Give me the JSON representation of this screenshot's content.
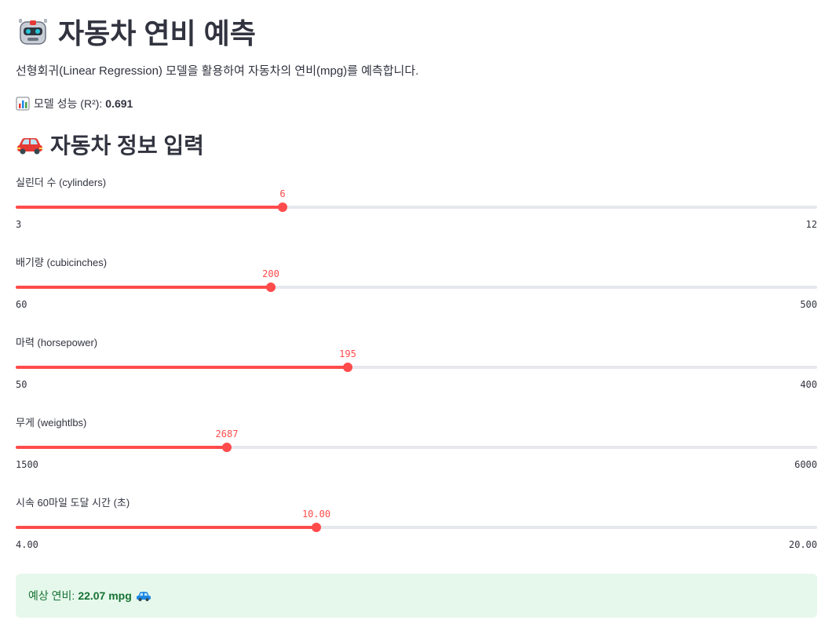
{
  "header": {
    "title": "자동차 연비 예측",
    "title_icon": "robot-icon",
    "description": "선형회귀(Linear Regression) 모델을 활용하여 자동차의 연비(mpg)를 예측합니다.",
    "performance_label": "모델 성능 (R²):",
    "performance_value": "0.691",
    "performance_icon": "bar-chart-icon"
  },
  "input_section": {
    "title": "자동차 정보 입력",
    "title_icon": "car-icon"
  },
  "sliders": [
    {
      "label": "실린더 수 (cylinders)",
      "value": "6",
      "min": "3",
      "max": "12",
      "fraction": 0.3333
    },
    {
      "label": "배기량 (cubicinches)",
      "value": "200",
      "min": "60",
      "max": "500",
      "fraction": 0.3182
    },
    {
      "label": "마력 (horsepower)",
      "value": "195",
      "min": "50",
      "max": "400",
      "fraction": 0.4143
    },
    {
      "label": "무게 (weightlbs)",
      "value": "2687",
      "min": "1500",
      "max": "6000",
      "fraction": 0.2638
    },
    {
      "label": "시속 60마일 도달 시간 (초)",
      "value": "10.00",
      "min": "4.00",
      "max": "20.00",
      "fraction": 0.375
    }
  ],
  "result": {
    "label": "예상 연비:",
    "value": "22.07 mpg",
    "icon": "car-icon"
  },
  "colors": {
    "accent": "#ff4b4b",
    "track": "#e6e8ee",
    "success_bg": "#e6f8ec",
    "success_text": "#177233",
    "text": "#31333f"
  }
}
